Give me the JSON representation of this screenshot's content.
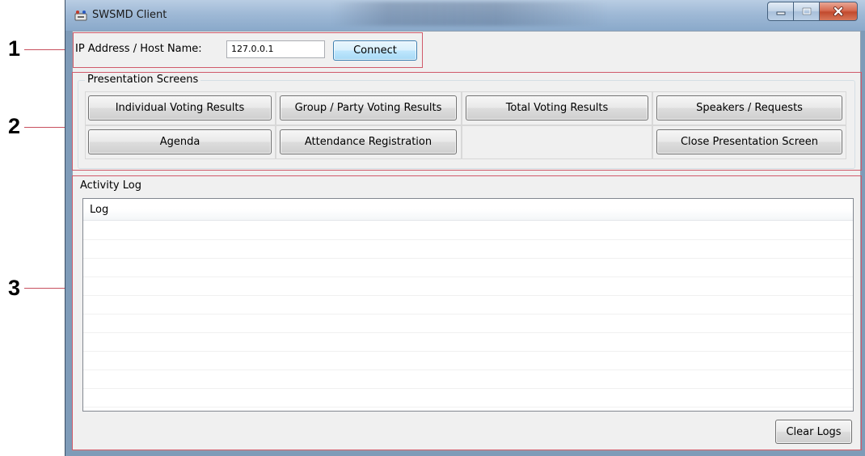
{
  "callouts": [
    "1",
    "2",
    "3"
  ],
  "window": {
    "title": "SWSMD Client",
    "app_icon": "app-logo-icon",
    "caption_buttons": [
      "minimize-icon",
      "maximize-icon",
      "close-icon"
    ]
  },
  "connection": {
    "host_label": "IP Address / Host Name:",
    "host_value": "127.0.0.1",
    "connect_label": "Connect"
  },
  "presentation": {
    "group_title": "Presentation Screens",
    "buttons": [
      "Individual Voting Results",
      "Group / Party Voting Results",
      "Total Voting Results",
      "Speakers / Requests",
      "Agenda",
      "Attendance Registration",
      "Close Presentation Screen"
    ]
  },
  "activity": {
    "group_title": "Activity Log",
    "column_header": "Log",
    "rows": [],
    "clear_label": "Clear Logs"
  },
  "colors": {
    "callout_red": "#d05a6a",
    "titlebar": "#9fb9d6",
    "close_button": "#c24a2e",
    "focused_button": "#3c7fb1"
  }
}
